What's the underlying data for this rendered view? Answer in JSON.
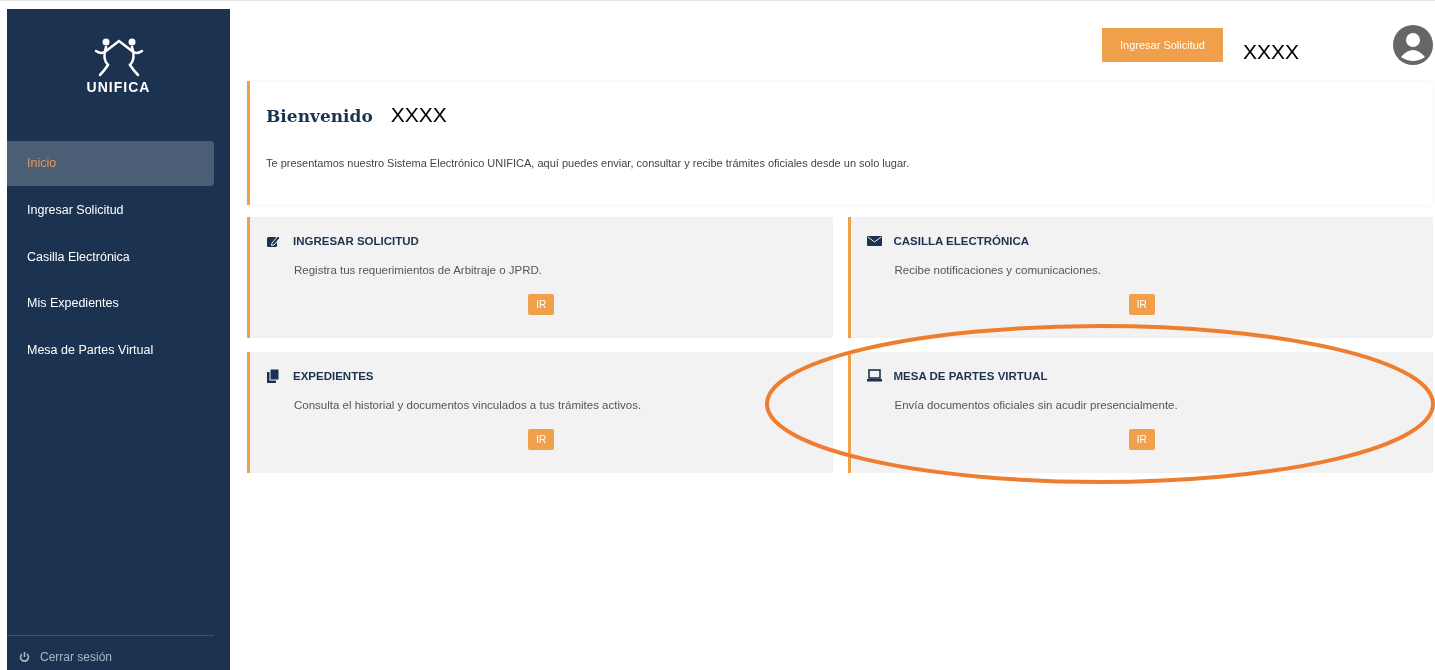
{
  "sidebar": {
    "brand": "UNIFICA",
    "items": [
      {
        "label": "Inicio",
        "selected": true
      },
      {
        "label": "Ingresar Solicitud",
        "selected": false
      },
      {
        "label": "Casilla Electrónica",
        "selected": false
      },
      {
        "label": "Mis Expedientes",
        "selected": false
      },
      {
        "label": "Mesa de Partes Virtual",
        "selected": false
      }
    ],
    "logout": "Cerrar sesión"
  },
  "topbar": {
    "button": "Ingresar Solicitud",
    "user": "XXXX"
  },
  "welcome": {
    "title": "Bienvenido",
    "user": "XXXX",
    "text": "Te presentamos nuestro Sistema Electrónico UNIFICA, aquí puedes enviar, consultar y recibe trámites oficiales desde un solo lugar."
  },
  "cards": [
    {
      "kind": "edit",
      "title": "INGRESAR SOLICITUD",
      "text": "Registra tus requerimientos de Arbitraje o JPRD.",
      "button": "IR"
    },
    {
      "kind": "mail",
      "title": "CASILLA ELECTRÓNICA",
      "text": "Recibe notificaciones y comunicaciones.",
      "button": "IR"
    },
    {
      "kind": "docs",
      "title": "EXPEDIENTES",
      "text": "Consulta el historial y documentos vinculados a tus trámites activos.",
      "button": "IR"
    },
    {
      "kind": "laptop",
      "title": "MESA DE PARTES VIRTUAL",
      "text": "Envía documentos oficiales sin acudir presencialmente.",
      "button": "IR"
    }
  ],
  "annotation": {
    "kind": "ellipse"
  }
}
